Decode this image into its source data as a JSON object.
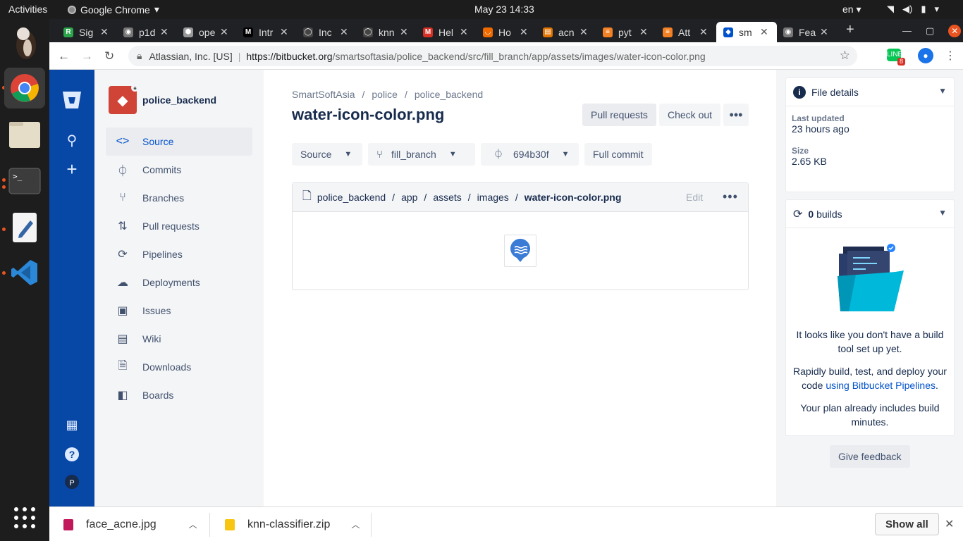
{
  "system": {
    "activities": "Activities",
    "app_name": "Google Chrome",
    "clock": "May 23  14:33",
    "lang": "en"
  },
  "tabs": [
    {
      "title": "Sig",
      "color": "#2ba64b",
      "glyph": "R"
    },
    {
      "title": "p1d",
      "color": "#777",
      "glyph": "◉"
    },
    {
      "title": "ope",
      "color": "#999",
      "glyph": "⬢"
    },
    {
      "title": "Intr",
      "color": "#000",
      "glyph": "M"
    },
    {
      "title": "Inc",
      "color": "#444",
      "glyph": "◯"
    },
    {
      "title": "knn",
      "color": "#444",
      "glyph": "◯"
    },
    {
      "title": "Hel",
      "color": "#d93025",
      "glyph": "M"
    },
    {
      "title": "Ho",
      "color": "#f06a00",
      "glyph": "◡"
    },
    {
      "title": "acn",
      "color": "#e37400",
      "glyph": "▤"
    },
    {
      "title": "pyt",
      "color": "#f48024",
      "glyph": "≡"
    },
    {
      "title": "Att",
      "color": "#f48024",
      "glyph": "≡"
    },
    {
      "title": "sm",
      "color": "#0052cc",
      "glyph": "◆"
    },
    {
      "title": "Fea",
      "color": "#777",
      "glyph": "◉"
    }
  ],
  "address": {
    "org": "Atlassian, Inc. [US]",
    "host": "https://bitbucket.org",
    "path": "/smartsoftasia/police_backend/src/fill_branch/app/assets/images/water-icon-color.png",
    "ext_badge": "8"
  },
  "global_nav": {
    "avatar_letter": "P"
  },
  "repo": {
    "name": "police_backend"
  },
  "sidebar": {
    "items": [
      {
        "label": "Source",
        "icon": "code-icon"
      },
      {
        "label": "Commits",
        "icon": "commit-icon"
      },
      {
        "label": "Branches",
        "icon": "branch-icon"
      },
      {
        "label": "Pull requests",
        "icon": "pull-request-icon"
      },
      {
        "label": "Pipelines",
        "icon": "pipelines-icon"
      },
      {
        "label": "Deployments",
        "icon": "deployments-icon"
      },
      {
        "label": "Issues",
        "icon": "issues-icon"
      },
      {
        "label": "Wiki",
        "icon": "wiki-icon"
      },
      {
        "label": "Downloads",
        "icon": "downloads-icon"
      },
      {
        "label": "Boards",
        "icon": "boards-icon"
      }
    ]
  },
  "main": {
    "breadcrumbs": [
      "SmartSoftAsia",
      "police",
      "police_backend"
    ],
    "file_title": "water-icon-color.png",
    "pull_requests": "Pull requests",
    "check_out": "Check out",
    "source_select": "Source",
    "branch_select": "fill_branch",
    "commit_select": "694b30f",
    "full_commit": "Full commit",
    "path": [
      "police_backend",
      "app",
      "assets",
      "images"
    ],
    "path_current": "water-icon-color.png",
    "edit": "Edit"
  },
  "file_details": {
    "header": "File details",
    "last_updated_label": "Last updated",
    "last_updated": "23 hours ago",
    "size_label": "Size",
    "size": "2.65 KB"
  },
  "builds": {
    "count": "0",
    "label": "builds",
    "msg1": "It looks like you don't have a build tool set up yet.",
    "msg2_pre": "Rapidly build, test, and deploy your code ",
    "msg2_link": "using Bitbucket Pipelines",
    "msg2_post": ".",
    "msg3": "Your plan already includes build minutes."
  },
  "feedback": "Give feedback",
  "downloads": {
    "files": [
      "face_acne.jpg",
      "knn-classifier.zip"
    ],
    "show_all": "Show all"
  }
}
